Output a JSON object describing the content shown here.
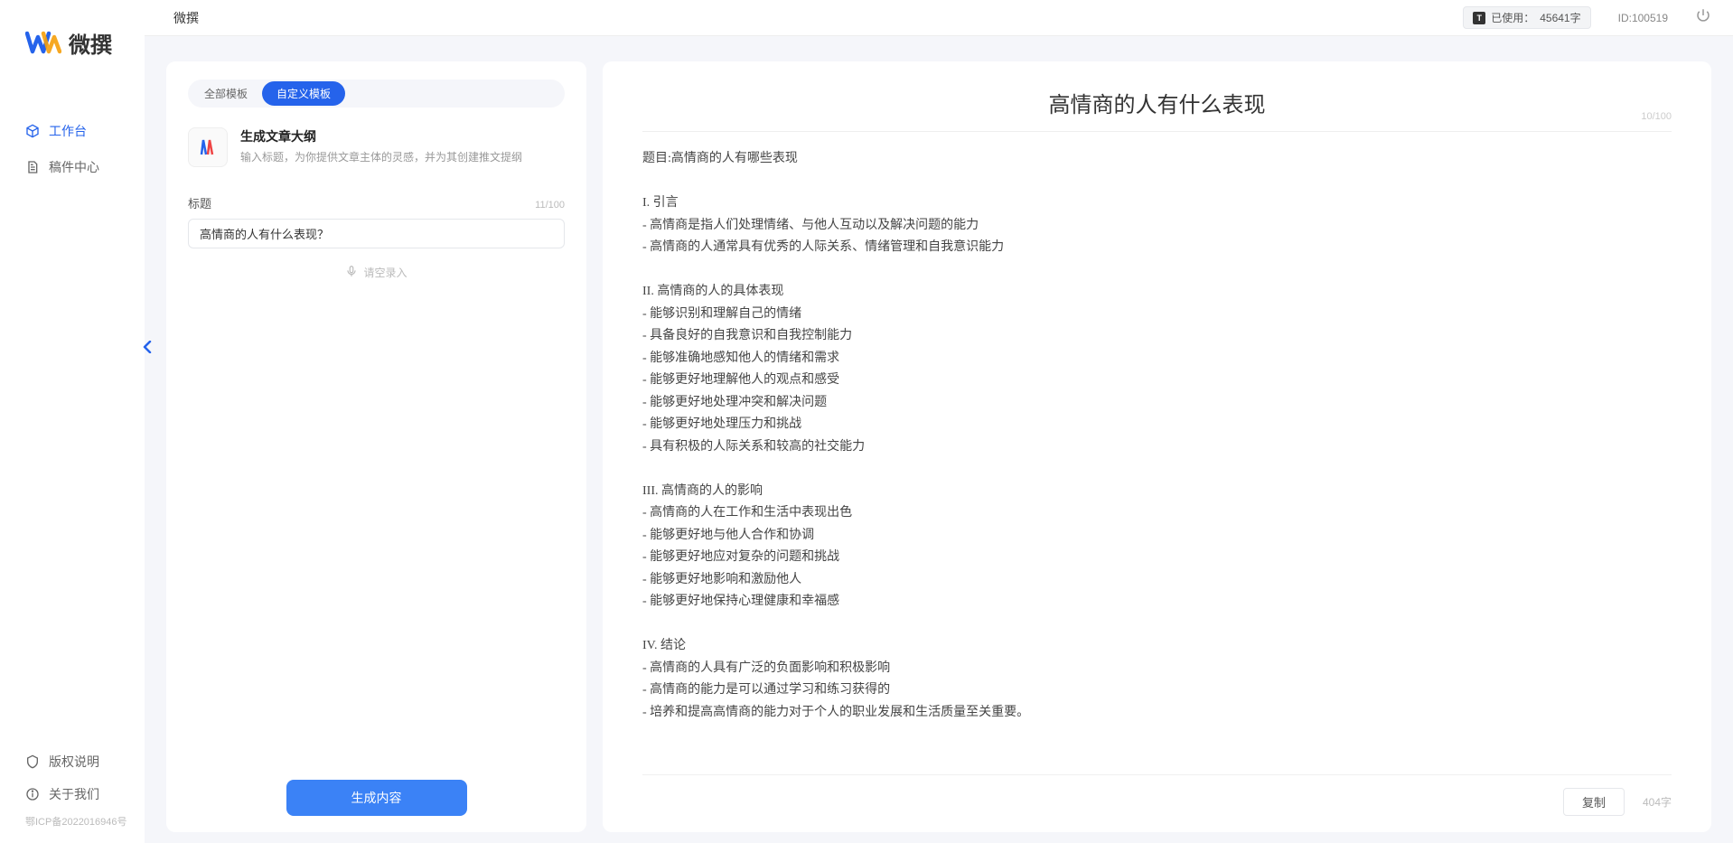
{
  "app": {
    "brand": "微撰",
    "title": "微撰",
    "usage_label_prefix": "已使用：",
    "usage_value": "45641字",
    "user_id_label": "ID:100519"
  },
  "sidebar": {
    "nav": [
      {
        "key": "workspace",
        "label": "工作台",
        "active": true
      },
      {
        "key": "drafts",
        "label": "稿件中心",
        "active": false
      }
    ],
    "footer": [
      {
        "key": "copyright",
        "label": "版权说明"
      },
      {
        "key": "about",
        "label": "关于我们"
      }
    ],
    "icp": "鄂ICP备2022016946号"
  },
  "left": {
    "tabs": [
      {
        "key": "all",
        "label": "全部模板",
        "active": false
      },
      {
        "key": "custom",
        "label": "自定义模板",
        "active": true
      }
    ],
    "template": {
      "title": "生成文章大纲",
      "desc": "输入标题，为你提供文章主体的灵感，并为其创建推文提纲"
    },
    "title_field": {
      "label": "标题",
      "value": "高情商的人有什么表现？",
      "counter": "11/100"
    },
    "voice_hint": "请空录入",
    "generate_button": "生成内容"
  },
  "right": {
    "title": "高情商的人有什么表现",
    "title_counter": "10/100",
    "body": "题目:高情商的人有哪些表现\n\nI. 引言\n- 高情商是指人们处理情绪、与他人互动以及解决问题的能力\n- 高情商的人通常具有优秀的人际关系、情绪管理和自我意识能力\n\nII. 高情商的人的具体表现\n- 能够识别和理解自己的情绪\n- 具备良好的自我意识和自我控制能力\n- 能够准确地感知他人的情绪和需求\n- 能够更好地理解他人的观点和感受\n- 能够更好地处理冲突和解决问题\n- 能够更好地处理压力和挑战\n- 具有积极的人际关系和较高的社交能力\n\nIII. 高情商的人的影响\n- 高情商的人在工作和生活中表现出色\n- 能够更好地与他人合作和协调\n- 能够更好地应对复杂的问题和挑战\n- 能够更好地影响和激励他人\n- 能够更好地保持心理健康和幸福感\n\nIV. 结论\n- 高情商的人具有广泛的负面影响和积极影响\n- 高情商的能力是可以通过学习和练习获得的\n- 培养和提高高情商的能力对于个人的职业发展和生活质量至关重要。",
    "copy_button": "复制",
    "word_count": "404字"
  }
}
